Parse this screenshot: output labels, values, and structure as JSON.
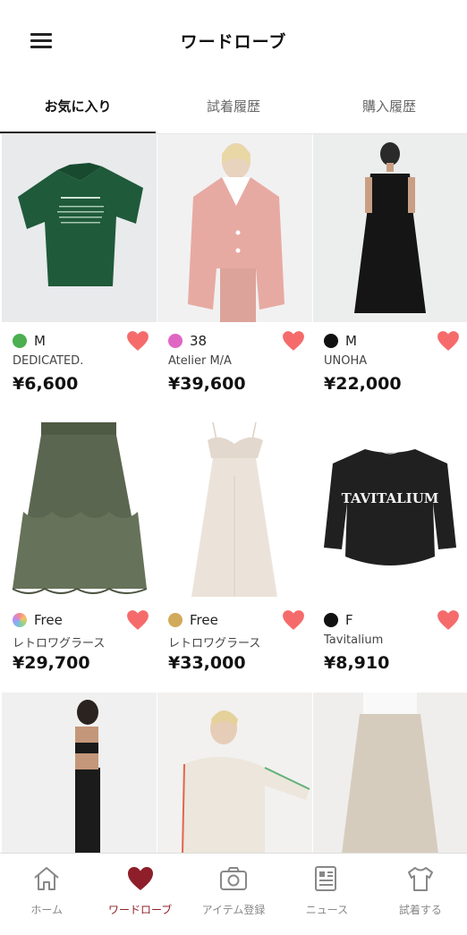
{
  "header": {
    "title": "ワードローブ",
    "menu_icon": "hamburger-menu-icon"
  },
  "tabs": [
    {
      "label": "お気に入り",
      "active": true
    },
    {
      "label": "試着履歴",
      "active": false
    },
    {
      "label": "購入履歴",
      "active": false
    }
  ],
  "items": [
    {
      "size": "M",
      "brand": "DEDICATED.",
      "price": "¥6,600",
      "dot_color": "#4caf50"
    },
    {
      "size": "38",
      "brand": "Atelier M/A",
      "price": "¥39,600",
      "dot_color": "#e066c4"
    },
    {
      "size": "M",
      "brand": "UNOHA",
      "price": "¥22,000",
      "dot_color": "#111111"
    },
    {
      "size": "Free",
      "brand": "レトロワグラース",
      "price": "¥29,700",
      "dot_color": "gradient"
    },
    {
      "size": "Free",
      "brand": "レトロワグラース",
      "price": "¥33,000",
      "dot_color": "#d2aa5c"
    },
    {
      "size": "F",
      "brand": "Tavitalium",
      "price": "¥8,910",
      "dot_color": "#111111"
    }
  ],
  "product_print": {
    "tavitalium_logo": "TAVITALIUM"
  },
  "bottom_nav": [
    {
      "label": "ホーム",
      "icon": "home-icon",
      "active": false
    },
    {
      "label": "ワードローブ",
      "icon": "heart-icon",
      "active": true
    },
    {
      "label": "アイテム登録",
      "icon": "camera-icon",
      "active": false
    },
    {
      "label": "ニュース",
      "icon": "newspaper-icon",
      "active": false
    },
    {
      "label": "試着する",
      "icon": "tshirt-icon",
      "active": false
    }
  ],
  "colors": {
    "heart": "#f56b6b",
    "accent": "#8e1f2a"
  }
}
